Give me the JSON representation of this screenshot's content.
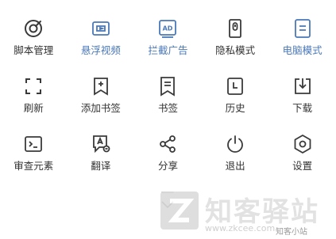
{
  "menu": {
    "items": [
      {
        "label": "脚本管理",
        "icon": "script-manager-icon",
        "active": false
      },
      {
        "label": "悬浮视频",
        "icon": "floating-video-icon",
        "active": true
      },
      {
        "label": "拦截广告",
        "icon": "ad-block-icon",
        "icon_text": "AD",
        "active": true
      },
      {
        "label": "隐私模式",
        "icon": "privacy-mode-icon",
        "active": false
      },
      {
        "label": "电脑模式",
        "icon": "desktop-mode-icon",
        "active": true
      },
      {
        "label": "刷新",
        "icon": "refresh-icon",
        "active": false
      },
      {
        "label": "添加书签",
        "icon": "add-bookmark-icon",
        "active": false
      },
      {
        "label": "书签",
        "icon": "bookmarks-icon",
        "active": false
      },
      {
        "label": "历史",
        "icon": "history-icon",
        "active": false
      },
      {
        "label": "下载",
        "icon": "download-icon",
        "active": false
      },
      {
        "label": "审查元素",
        "icon": "inspect-element-icon",
        "active": false
      },
      {
        "label": "翻译",
        "icon": "translate-icon",
        "active": false
      },
      {
        "label": "分享",
        "icon": "share-icon",
        "active": false
      },
      {
        "label": "退出",
        "icon": "exit-icon",
        "active": false
      },
      {
        "label": "设置",
        "icon": "settings-icon",
        "active": false
      }
    ]
  },
  "colors": {
    "icon": "#3a3a3a",
    "active": "#4a78b8",
    "label": "#333333"
  },
  "watermark": {
    "title": "知客驿站",
    "url": "www.zkcee.com",
    "channel": "知客小站"
  }
}
